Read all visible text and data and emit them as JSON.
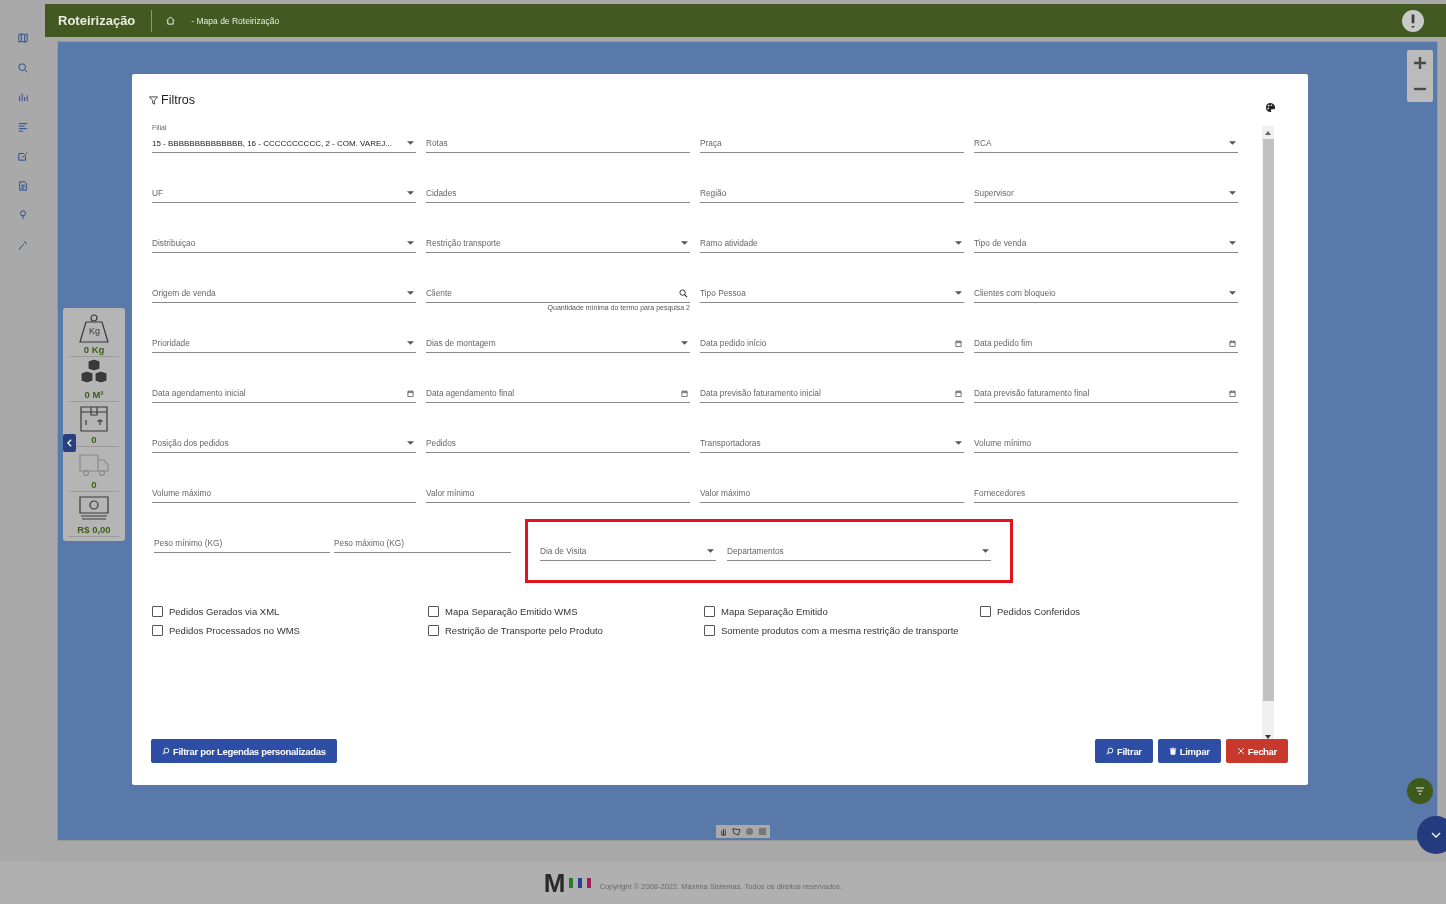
{
  "app": {
    "title": "Roteirização",
    "breadcrumb": "- Mapa de Roteirização"
  },
  "stats": [
    {
      "kind": "weight",
      "value": "0 Kg",
      "weight_label": "Kg"
    },
    {
      "kind": "cubes",
      "value": "0 M³"
    },
    {
      "kind": "box",
      "value": "0"
    },
    {
      "kind": "truck",
      "value": "0"
    },
    {
      "kind": "money",
      "value": "R$ 0,00"
    }
  ],
  "modal": {
    "title": "Filtros",
    "rows": [
      [
        {
          "label": "Filial",
          "kind": "select",
          "value": "15 - BBBBBBBBBBBBBB, 16 - CCCCCCCCCC, 2 - COM. VAREJ..."
        },
        {
          "label": "Rotas",
          "kind": "text"
        },
        {
          "label": "Praça",
          "kind": "text"
        },
        {
          "label": "RCA",
          "kind": "select"
        }
      ],
      [
        {
          "label": "UF",
          "kind": "select"
        },
        {
          "label": "Cidades",
          "kind": "text"
        },
        {
          "label": "Região",
          "kind": "text"
        },
        {
          "label": "Supervisor",
          "kind": "select"
        }
      ],
      [
        {
          "label": "Distribuiçao",
          "kind": "select"
        },
        {
          "label": "Restrição transporte",
          "kind": "select"
        },
        {
          "label": "Ramo atividade",
          "kind": "select"
        },
        {
          "label": "Tipo de venda",
          "kind": "select"
        }
      ],
      [
        {
          "label": "Origem de venda",
          "kind": "select"
        },
        {
          "label": "Cliente",
          "kind": "search",
          "hint": "Quantidade mínima do termo para pesquisa 2"
        },
        {
          "label": "Tipo Pessoa",
          "kind": "select"
        },
        {
          "label": "Clientes com bloqueio",
          "kind": "select"
        }
      ],
      [
        {
          "label": "Prioridade",
          "kind": "select"
        },
        {
          "label": "Dias de montagem",
          "kind": "select"
        },
        {
          "label": "Data pedido início",
          "kind": "date"
        },
        {
          "label": "Data pedido fim",
          "kind": "date"
        }
      ],
      [
        {
          "label": "Data agendamento inicial",
          "kind": "date"
        },
        {
          "label": "Data agendamento final",
          "kind": "date"
        },
        {
          "label": "Data previsão faturamento inicial",
          "kind": "date"
        },
        {
          "label": "Data previsão faturamento final",
          "kind": "date"
        }
      ],
      [
        {
          "label": "Posição dos pedidos",
          "kind": "select"
        },
        {
          "label": "Pedidos",
          "kind": "text"
        },
        {
          "label": "Transportadoras",
          "kind": "select"
        },
        {
          "label": "Volume mínimo",
          "kind": "text"
        }
      ],
      [
        {
          "label": "Volume máximo",
          "kind": "text"
        },
        {
          "label": "Valor mínimo",
          "kind": "text"
        },
        {
          "label": "Valor máximo",
          "kind": "text"
        },
        {
          "label": "Fornecedores",
          "kind": "text"
        }
      ],
      [
        {
          "label": "Peso mínimo (KG)",
          "kind": "text",
          "highlighted": false
        },
        {
          "label": "Peso máximo (KG)",
          "kind": "text",
          "highlighted": false
        },
        {
          "label": "Dia de Visita",
          "kind": "select",
          "highlighted": true
        },
        {
          "label": "Departamentos",
          "kind": "select",
          "highlighted": true
        }
      ]
    ],
    "checkboxes": [
      {
        "label": "Pedidos Gerados via XML",
        "checked": false
      },
      {
        "label": "Mapa Separação Emitido WMS",
        "checked": false
      },
      {
        "label": "Mapa Separação Emitido",
        "checked": false
      },
      {
        "label": "Pedidos Conferidos",
        "checked": false
      },
      {
        "label": "Pedidos Processados no WMS",
        "checked": false
      },
      {
        "label": "Restrição de Transporte pelo Produto",
        "checked": false
      },
      {
        "label": "Somente produtos com a mesma restrição de transporte",
        "checked": false
      }
    ],
    "legend_button": "Filtrar por Legendas personalizadas",
    "buttons": [
      {
        "kind": "filter",
        "label": "Filtrar"
      },
      {
        "kind": "clear",
        "label": "Limpar"
      },
      {
        "kind": "close",
        "label": "Fechar"
      }
    ]
  },
  "footer": {
    "logo": "M",
    "copyright": "Copyright © 2008-2022. Máxima Sistemas. Todos os direitos reservados."
  }
}
